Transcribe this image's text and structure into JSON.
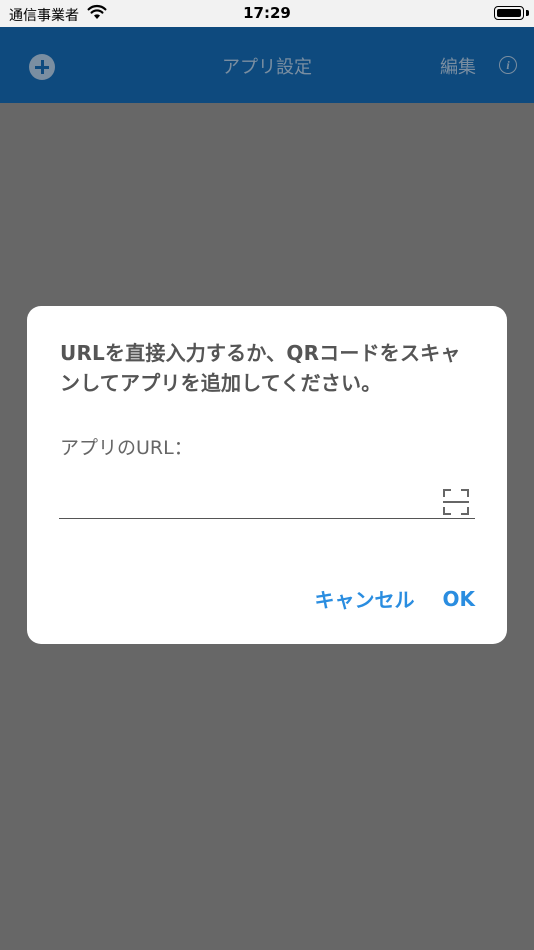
{
  "status_bar": {
    "carrier": "通信事業者",
    "time": "17:29"
  },
  "nav_bar": {
    "title": "アプリ設定",
    "edit_label": "編集",
    "info_label": "i",
    "add_icon": "plus-circle-icon",
    "background_color": "#0e4a7e"
  },
  "dialog": {
    "message": "URLを直接入力するか、QRコードをスキャンしてアプリを追加してください。",
    "field_label": "アプリのURL：",
    "input_value": "",
    "qr_icon": "qr-scan-icon",
    "cancel_label": "キャンセル",
    "ok_label": "OK",
    "accent_color": "#2a8de0"
  }
}
